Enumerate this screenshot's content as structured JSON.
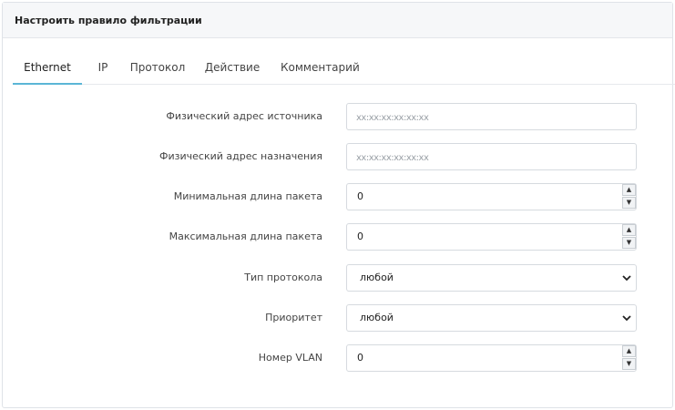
{
  "panel": {
    "title": "Настроить правило фильтрации"
  },
  "tabs": [
    {
      "label": "Ethernet",
      "active": true
    },
    {
      "label": "IP"
    },
    {
      "label": "Протокол"
    },
    {
      "label": "Действие"
    },
    {
      "label": "Комментарий"
    }
  ],
  "form": {
    "src_mac": {
      "label": "Физический адрес источника",
      "placeholder": "xx:xx:xx:xx:xx:xx",
      "value": ""
    },
    "dst_mac": {
      "label": "Физический адрес назначения",
      "placeholder": "xx:xx:xx:xx:xx:xx",
      "value": ""
    },
    "min_len": {
      "label": "Минимальная длина пакета",
      "value": "0"
    },
    "max_len": {
      "label": "Максимальная длина пакета",
      "value": "0"
    },
    "proto_type": {
      "label": "Тип протокола",
      "value": "любой"
    },
    "priority": {
      "label": "Приоритет",
      "value": "любой"
    },
    "vlan": {
      "label": "Номер VLAN",
      "value": "0"
    }
  },
  "colors": {
    "accent": "#5bb6d6",
    "border": "#d6dadf",
    "header_bg": "#f6f7f9"
  },
  "icons": {
    "spin_up": "triangle-up-icon",
    "spin_down": "triangle-down-icon",
    "select": "chevron-down-icon"
  }
}
